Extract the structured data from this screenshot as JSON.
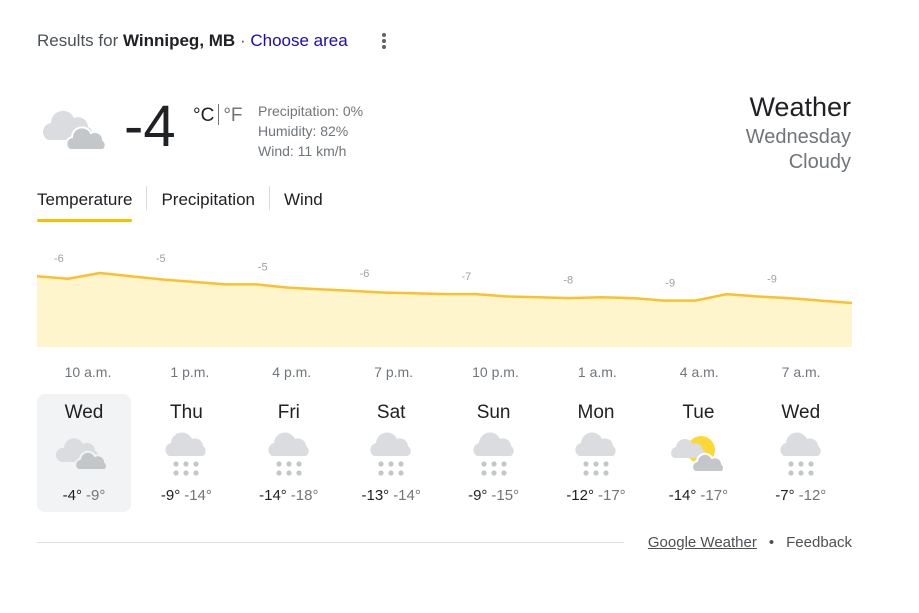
{
  "header": {
    "prefix": "Results for",
    "location": "Winnipeg, MB",
    "separator": "·",
    "choose_area": "Choose area"
  },
  "current": {
    "icon": "cloudy-icon",
    "temperature": "-4",
    "unit_c": "°C",
    "unit_f": "°F",
    "precipitation": "Precipitation: 0%",
    "humidity": "Humidity: 82%",
    "wind": "Wind: 11 km/h"
  },
  "summary": {
    "title": "Weather",
    "day": "Wednesday",
    "condition": "Cloudy"
  },
  "tabs": [
    {
      "label": "Temperature",
      "active": true
    },
    {
      "label": "Precipitation",
      "active": false
    },
    {
      "label": "Wind",
      "active": false
    }
  ],
  "chart_data": {
    "type": "area",
    "x": [
      "10 a.m.",
      "1 p.m.",
      "4 p.m.",
      "7 p.m.",
      "10 p.m.",
      "1 a.m.",
      "4 a.m.",
      "7 a.m."
    ],
    "labels": [
      "-6",
      "-5",
      "-5",
      "-6",
      "-7",
      "-8",
      "-9",
      "-9"
    ],
    "y": [
      -4.9,
      -5.2,
      -4.5,
      -4.9,
      -5.3,
      -5.6,
      -5.9,
      -5.9,
      -6.3,
      -6.5,
      -6.7,
      -6.9,
      -7.0,
      -7.1,
      -7.1,
      -7.4,
      -7.5,
      -7.6,
      -7.5,
      -7.6,
      -7.9,
      -7.9,
      -7.1,
      -7.4,
      -7.6,
      -7.9,
      -8.2
    ],
    "line_color": "#fbc02d",
    "fill_color": "#fef5cc"
  },
  "forecast": [
    {
      "day": "Wed",
      "icon": "cloudy-icon",
      "high": "-4°",
      "low": "-9°",
      "selected": true
    },
    {
      "day": "Thu",
      "icon": "snow-icon",
      "high": "-9°",
      "low": "-14°",
      "selected": false
    },
    {
      "day": "Fri",
      "icon": "snow-icon",
      "high": "-14°",
      "low": "-18°",
      "selected": false
    },
    {
      "day": "Sat",
      "icon": "snow-icon",
      "high": "-13°",
      "low": "-14°",
      "selected": false
    },
    {
      "day": "Sun",
      "icon": "snow-icon",
      "high": "-9°",
      "low": "-15°",
      "selected": false
    },
    {
      "day": "Mon",
      "icon": "snow-icon",
      "high": "-12°",
      "low": "-17°",
      "selected": false
    },
    {
      "day": "Tue",
      "icon": "partly-sunny-icon",
      "high": "-14°",
      "low": "-17°",
      "selected": false
    },
    {
      "day": "Wed",
      "icon": "snow-icon",
      "high": "-7°",
      "low": "-12°",
      "selected": false
    }
  ],
  "footer": {
    "source": "Google Weather",
    "separator": "•",
    "feedback": "Feedback"
  }
}
